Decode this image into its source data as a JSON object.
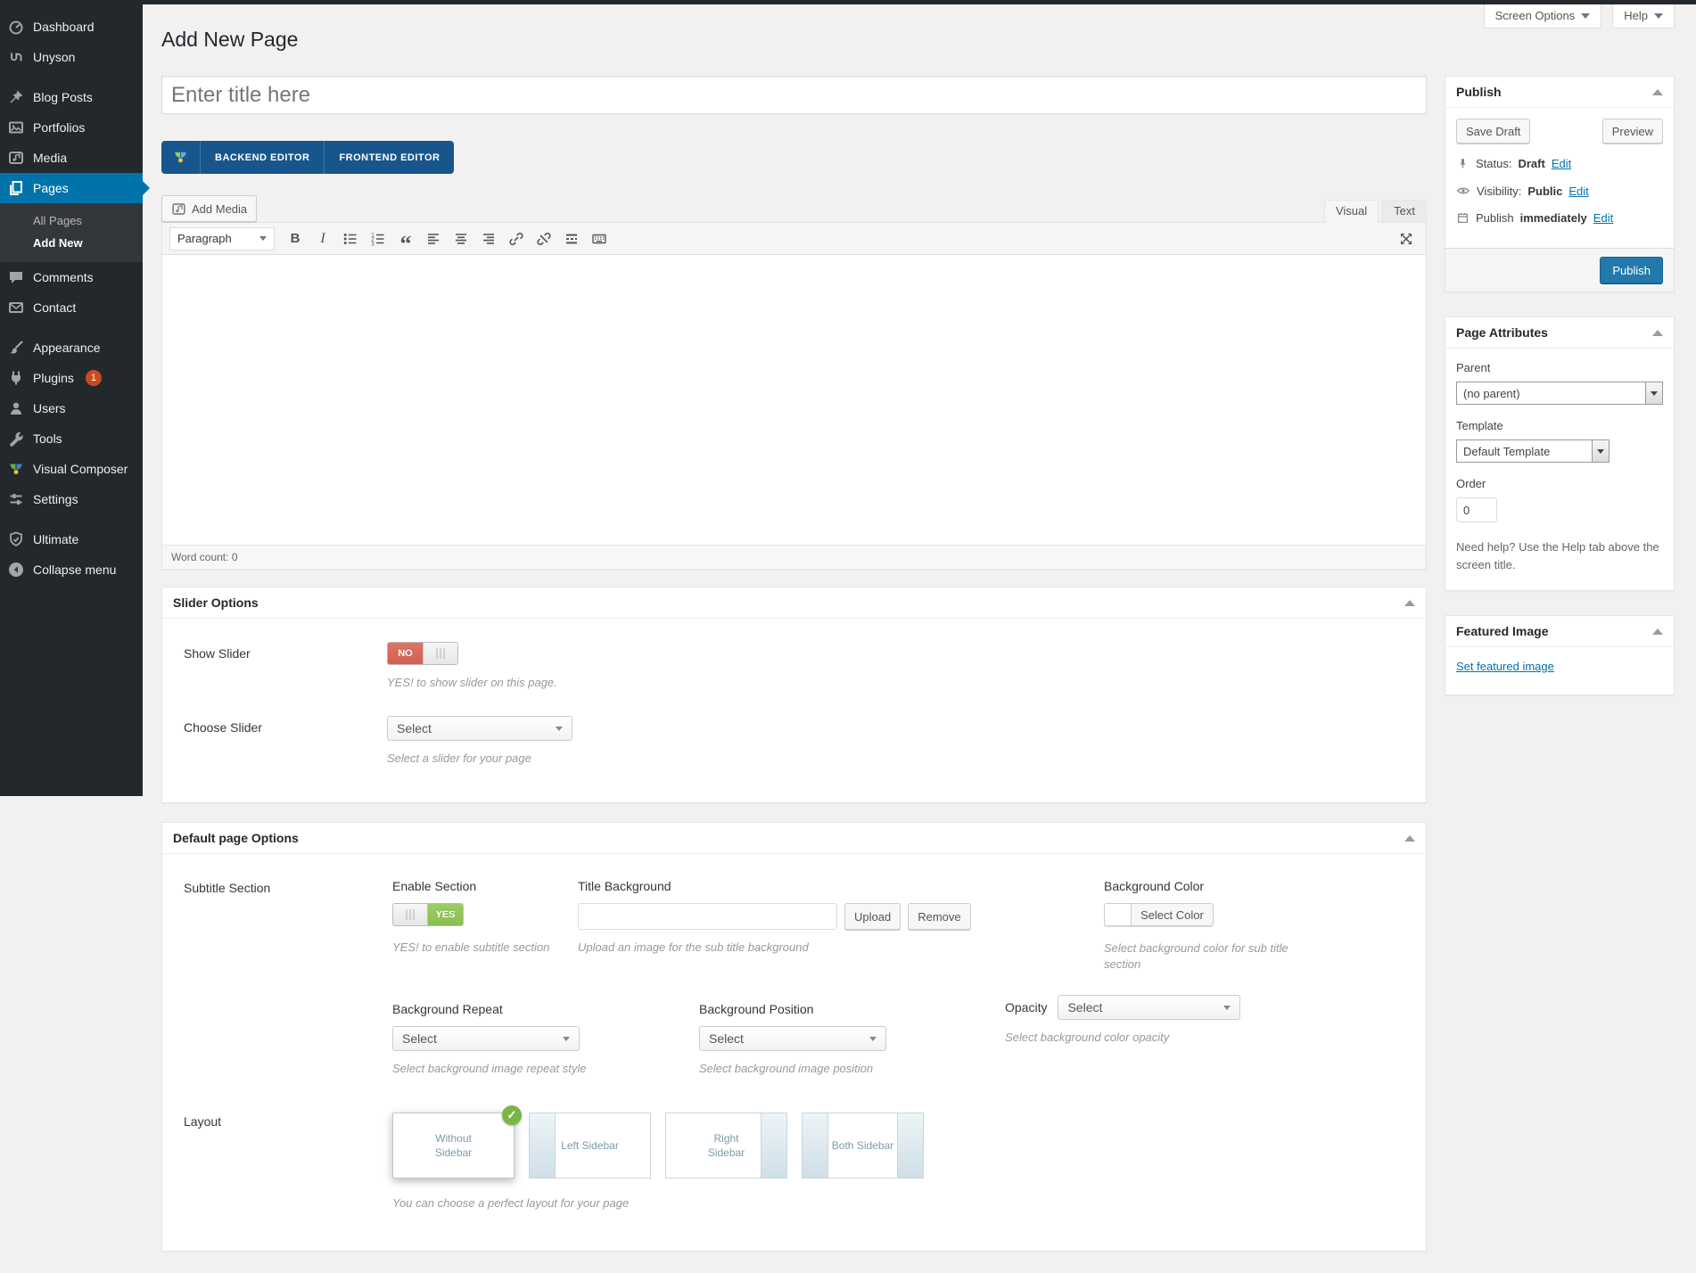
{
  "chrome": {
    "screen_options": "Screen Options",
    "help": "Help"
  },
  "sidebar": {
    "items": [
      {
        "label": "Dashboard",
        "icon": "dashboard-icon"
      },
      {
        "label": "Unyson",
        "icon": "unyson-icon"
      },
      {
        "label": "Blog Posts",
        "icon": "pushpin-icon"
      },
      {
        "label": "Portfolios",
        "icon": "portfolio-icon"
      },
      {
        "label": "Media",
        "icon": "media-icon"
      },
      {
        "label": "Pages",
        "icon": "pages-icon"
      },
      {
        "label": "Comments",
        "icon": "comment-icon"
      },
      {
        "label": "Contact",
        "icon": "envelope-icon"
      },
      {
        "label": "Appearance",
        "icon": "brush-icon"
      },
      {
        "label": "Plugins",
        "icon": "plugin-icon",
        "badge": "1"
      },
      {
        "label": "Users",
        "icon": "user-icon"
      },
      {
        "label": "Tools",
        "icon": "wrench-icon"
      },
      {
        "label": "Visual Composer",
        "icon": "visual-composer-icon"
      },
      {
        "label": "Settings",
        "icon": "sliders-icon"
      },
      {
        "label": "Ultimate",
        "icon": "shield-icon"
      },
      {
        "label": "Collapse menu",
        "icon": "collapse-arrow-icon"
      }
    ],
    "submenu": {
      "items": [
        {
          "label": "All Pages"
        },
        {
          "label": "Add New"
        }
      ]
    }
  },
  "page": {
    "title": "Add New Page"
  },
  "editor": {
    "title_placeholder": "Enter title here",
    "vc": {
      "backend": "BACKEND EDITOR",
      "frontend": "FRONTEND EDITOR"
    },
    "add_media": "Add Media",
    "tabs": {
      "visual": "Visual",
      "text": "Text"
    },
    "paragraph": "Paragraph",
    "toolbar_icons": [
      "bold-icon",
      "italic-icon",
      "bullet-list-icon",
      "numbered-list-icon",
      "blockquote-icon",
      "align-left-icon",
      "align-center-icon",
      "align-right-icon",
      "link-icon",
      "unlink-icon",
      "read-more-icon",
      "keyboard-icon",
      "fullscreen-icon"
    ],
    "word_count_label": "Word count:",
    "word_count_value": "0"
  },
  "slider_options": {
    "title": "Slider Options",
    "show_slider": {
      "label": "Show Slider",
      "toggle_off": "NO",
      "help": "YES! to show slider on this page."
    },
    "choose_slider": {
      "label": "Choose Slider",
      "value": "Select",
      "help": "Select a slider for your page"
    }
  },
  "default_page_options": {
    "title": "Default page Options",
    "subtitle_section_label": "Subtitle Section",
    "enable_section": {
      "label": "Enable Section",
      "toggle_on": "YES",
      "help": "YES! to enable subtitle section"
    },
    "title_background": {
      "label": "Title Background",
      "value": "",
      "upload": "Upload",
      "remove": "Remove",
      "help": "Upload an image for the sub title background"
    },
    "background_color": {
      "label": "Background Color",
      "button": "Select Color",
      "help": "Select background color for sub title section"
    },
    "background_repeat": {
      "label": "Background Repeat",
      "value": "Select",
      "help": "Select background image repeat style"
    },
    "background_position": {
      "label": "Background Position",
      "value": "Select",
      "help": "Select background image position"
    },
    "opacity": {
      "label": "Opacity",
      "value": "Select",
      "help": "Select background color opacity"
    },
    "layout": {
      "label": "Layout",
      "options": [
        {
          "label": "Without Sidebar",
          "selected": true
        },
        {
          "label": "Left Sidebar"
        },
        {
          "label": "Right Sidebar"
        },
        {
          "label": "Both Sidebar"
        }
      ],
      "help": "You can choose a perfect layout for your page"
    }
  },
  "publish_box": {
    "title": "Publish",
    "save_draft": "Save Draft",
    "preview": "Preview",
    "status_label": "Status:",
    "status_value": "Draft",
    "visibility_label": "Visibility:",
    "visibility_value": "Public",
    "publish_time_label": "Publish",
    "publish_time_value": "immediately",
    "edit": "Edit",
    "publish_button": "Publish"
  },
  "page_attributes": {
    "title": "Page Attributes",
    "parent_label": "Parent",
    "parent_value": "(no parent)",
    "template_label": "Template",
    "template_value": "Default Template",
    "order_label": "Order",
    "order_value": "0",
    "help": "Need help? Use the Help tab above the screen title."
  },
  "featured_image": {
    "title": "Featured Image",
    "link": "Set featured image"
  },
  "colors": {
    "accent": "#0073aa",
    "sidebar_bg": "#23282d",
    "submenu_bg": "#32373c",
    "badge": "#ca4a1f",
    "toggle_off": "#d9695f",
    "toggle_on": "#8abf4e",
    "vc_bar": "#17568c",
    "publish_button": "#2379ab",
    "page_bg": "#f1f1f1"
  }
}
